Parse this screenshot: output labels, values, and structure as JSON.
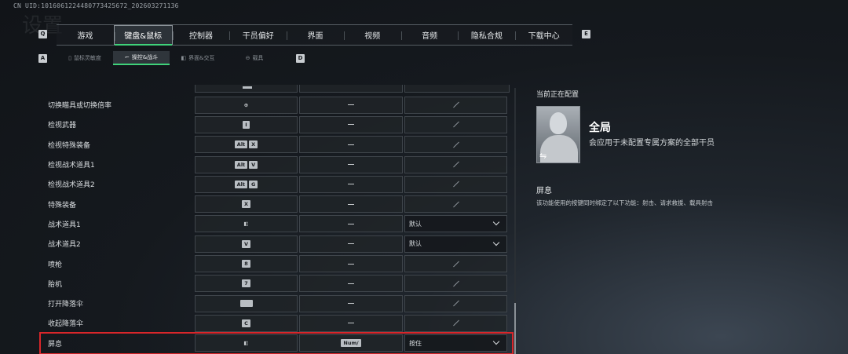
{
  "uid": "CN UID:1016061224480773425672_202603271136",
  "top_nav": {
    "left_hint": "Q",
    "right_hint": "E",
    "tabs": [
      "游戏",
      "键盘&鼠标",
      "控制器",
      "干员偏好",
      "界面",
      "视频",
      "音频",
      "隐私合规",
      "下载中心"
    ],
    "active_index": 1
  },
  "sub_nav": {
    "left_hint": "A",
    "right_hint": "D",
    "tabs": [
      {
        "label": "鼠标灵敏度",
        "icon": "mouse-icon"
      },
      {
        "label": "操控&战斗",
        "icon": "gun-icon"
      },
      {
        "label": "界面&交互",
        "icon": "interface-icon"
      },
      {
        "label": "载具",
        "icon": "vehicle-icon"
      }
    ],
    "active_index": 1
  },
  "bindings": [
    {
      "name": "切换瞄具或切换倍率",
      "primary": [
        "mouse-middle"
      ],
      "secondary": "—",
      "mode": ""
    },
    {
      "name": "检视武器",
      "primary": [
        "I"
      ],
      "secondary": "—",
      "mode": ""
    },
    {
      "name": "检视特殊装备",
      "primary": [
        "Alt",
        "X"
      ],
      "secondary": "—",
      "mode": ""
    },
    {
      "name": "检视战术道具1",
      "primary": [
        "Alt",
        "V"
      ],
      "secondary": "—",
      "mode": ""
    },
    {
      "name": "检视战术道具2",
      "primary": [
        "Alt",
        "G"
      ],
      "secondary": "—",
      "mode": ""
    },
    {
      "name": "特殊装备",
      "primary": [
        "X"
      ],
      "secondary": "—",
      "mode": ""
    },
    {
      "name": "战术道具1",
      "primary": [
        "mouse-side"
      ],
      "secondary": "—",
      "mode": "默认"
    },
    {
      "name": "战术道具2",
      "primary": [
        "V"
      ],
      "secondary": "—",
      "mode": "默认"
    },
    {
      "name": "喷枪",
      "primary": [
        "8"
      ],
      "secondary": "—",
      "mode": ""
    },
    {
      "name": "胎机",
      "primary": [
        "7"
      ],
      "secondary": "—",
      "mode": ""
    },
    {
      "name": "打开降落伞",
      "primary": [
        "space"
      ],
      "secondary": "—",
      "mode": ""
    },
    {
      "name": "收起降落伞",
      "primary": [
        "C"
      ],
      "secondary": "—",
      "mode": ""
    },
    {
      "name": "屏息",
      "primary": [
        "mouse-side"
      ],
      "secondary": "Num/",
      "mode": "按住"
    }
  ],
  "highlighted_row": 12,
  "right_panel": {
    "config_title": "当前正在配置",
    "profile_name": "全局",
    "profile_desc": "会应用于未配置专属方案的全部干员",
    "detail_title": "屏息",
    "detail_desc": "该功能使用的按键同时绑定了以下功能：射击、请求救援、载具射击"
  },
  "colors": {
    "accent": "#3fd27a",
    "highlight": "#d9262a"
  }
}
